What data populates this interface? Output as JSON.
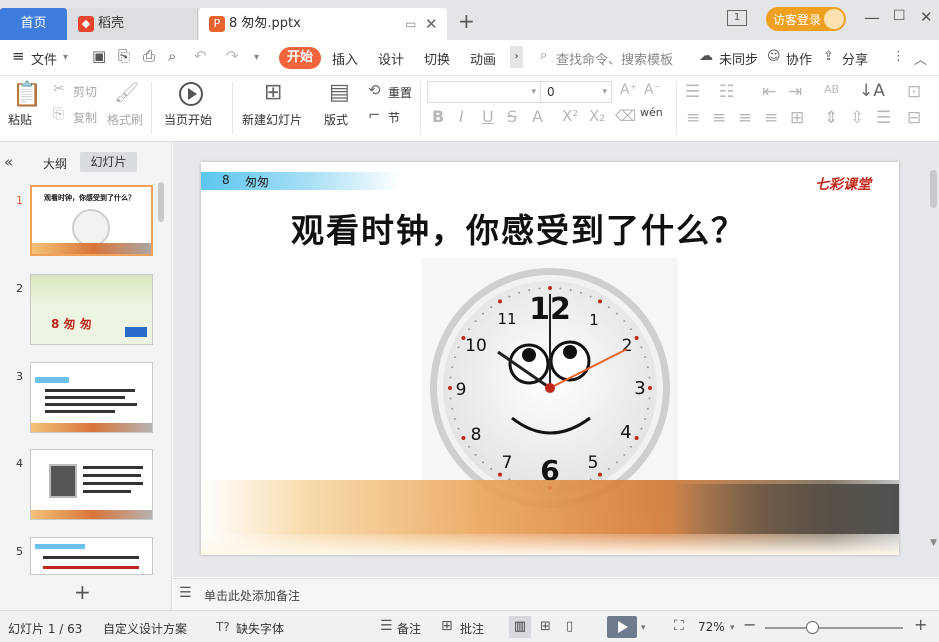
{
  "tabs": {
    "home": "首页",
    "daoke": "稻壳",
    "doc": "8 匆匆.pptx",
    "login": "访客登录"
  },
  "menu": {
    "file": "文件",
    "start": "开始",
    "insert": "插入",
    "design": "设计",
    "switch": "切换",
    "animation": "动画",
    "search_placeholder": "查找命令、搜索模板",
    "unsync": "未同步",
    "collab": "协作",
    "share": "分享"
  },
  "ribbon": {
    "paste": "粘贴",
    "cut": "剪切",
    "copy": "复制",
    "format_painter": "格式刷",
    "from_start": "当页开始",
    "new_slide": "新建幻灯片",
    "layout": "版式",
    "reset": "重置",
    "section": "节",
    "font_size": "0"
  },
  "left_panel": {
    "outline_tab": "大纲",
    "slides_tab": "幻灯片",
    "slide_numbers": [
      "1",
      "2",
      "3",
      "4",
      "5"
    ],
    "thumb1_title": "观看时钟，你感受到了什么？",
    "thumb2_title": "8 匆 匆"
  },
  "slide": {
    "header_number": "8",
    "header_title": "匆匆",
    "logo": "七彩课堂",
    "title": "观看时钟，你感受到了什么？",
    "clock_numbers": [
      "12",
      "1",
      "2",
      "3",
      "4",
      "5",
      "6",
      "7",
      "8",
      "9",
      "10",
      "11"
    ]
  },
  "notes": {
    "placeholder": "单击此处添加备注"
  },
  "status": {
    "slide_count": "幻灯片 1 / 63",
    "design": "自定义设计方案",
    "missing_fonts": "缺失字体",
    "notes": "备注",
    "comments": "批注",
    "zoom": "72%"
  },
  "colors": {
    "accent_blue": "#3e7cde",
    "start_orange": "#f0653b",
    "login_gold": "#f0a020"
  }
}
